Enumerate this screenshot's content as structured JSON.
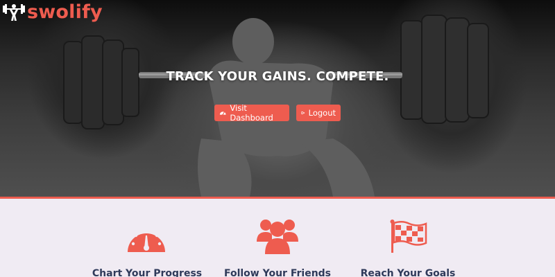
{
  "brand": {
    "name": "swolify",
    "accent_color": "#ee5c4f",
    "logo_icon": "weightlifter-icon"
  },
  "hero": {
    "headline": "TRACK YOUR GAINS. COMPETE.",
    "background": "weightlifter-squat-photo",
    "buttons": [
      {
        "label": "Visit Dashboard",
        "icon": "dashboard-icon"
      },
      {
        "label": "Logout",
        "icon": "sign-out-icon"
      }
    ]
  },
  "features": [
    {
      "title": "Chart Your Progress",
      "icon": "speedometer-icon"
    },
    {
      "title": "Follow Your Friends",
      "icon": "users-icon"
    },
    {
      "title": "Reach Your Goals",
      "icon": "checkered-flag-icon"
    }
  ],
  "colors": {
    "feature_title": "#2f3a5a",
    "section_background": "#f0ebf3"
  }
}
